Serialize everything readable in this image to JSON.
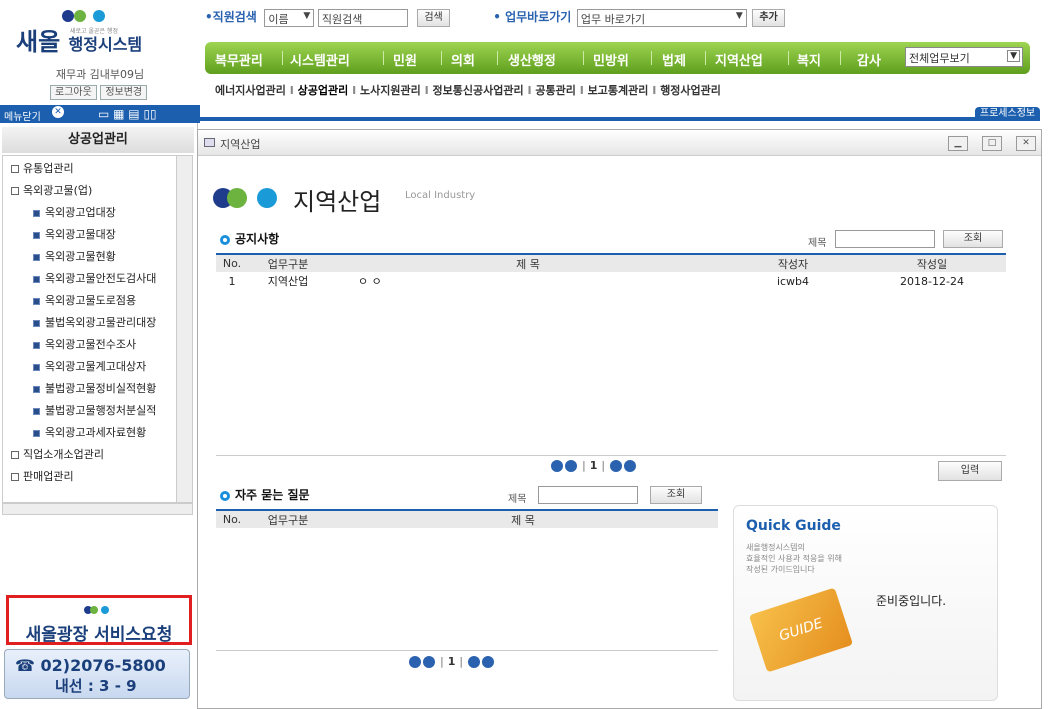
{
  "logo": {
    "title": "새올",
    "subtitle": "행정시스템",
    "tagline": "새로고 올곧은 행정",
    "user": "재무과 김내부09님",
    "logout": "로그아웃",
    "change_info": "정보변경"
  },
  "menu_bar": {
    "label": "메뉴닫기"
  },
  "search": {
    "label": "•직원검색",
    "select_value": "이름",
    "input_value": "직원검색",
    "button": "검색"
  },
  "quick": {
    "label": "• 업무바로가기",
    "select_value": "업무 바로가기",
    "add_button": "추가"
  },
  "nav": {
    "items": [
      "복무관리",
      "시스템관리",
      "민원",
      "의회",
      "생산행정",
      "민방위",
      "법제",
      "지역산업",
      "복지",
      "감사"
    ],
    "select_value": "전체업무보기"
  },
  "subnav": {
    "items": [
      "에너지사업관리",
      "상공업관리",
      "노사지원관리",
      "정보통신공사업관리",
      "공통관리",
      "보고통계관리",
      "행정사업관리"
    ]
  },
  "process_button": "프로세스정보",
  "sidebar": {
    "title": "상공업관리",
    "tree": [
      {
        "label": "유통업관리",
        "type": "folder"
      },
      {
        "label": "옥외광고물(업)",
        "type": "folder-open"
      },
      {
        "label": "옥외광고업대장",
        "type": "leaf"
      },
      {
        "label": "옥외광고물대장",
        "type": "leaf"
      },
      {
        "label": "옥외광고물현황",
        "type": "leaf"
      },
      {
        "label": "옥외광고물안전도검사대",
        "type": "leaf"
      },
      {
        "label": "옥외광고물도로점용",
        "type": "leaf"
      },
      {
        "label": "불법옥외광고물관리대장",
        "type": "leaf"
      },
      {
        "label": "옥외광고물전수조사",
        "type": "leaf"
      },
      {
        "label": "옥외광고물계고대상자",
        "type": "leaf"
      },
      {
        "label": "불법광고물정비실적현황",
        "type": "leaf"
      },
      {
        "label": "불법광고물행정처분실적",
        "type": "leaf"
      },
      {
        "label": "옥외광고과세자료현황",
        "type": "leaf"
      },
      {
        "label": "직업소개소업관리",
        "type": "folder"
      },
      {
        "label": "판매업관리",
        "type": "folder"
      }
    ],
    "service_request": "새올광장 서비스요청",
    "phone": "02)2076-5800",
    "extension": "내선 : 3 - 9"
  },
  "window": {
    "title": "지역산업",
    "page_title": "지역산업",
    "page_title_en": "Local Industry"
  },
  "notice": {
    "title": "공지사항",
    "search_label": "제목",
    "search_button": "조회",
    "columns": [
      "No.",
      "업무구분",
      "제 목",
      "작성자",
      "작성일"
    ],
    "rows": [
      {
        "no": "1",
        "category": "지역산업",
        "subject": "ㅇ ㅇ",
        "author": "icwb4",
        "date": "2018-12-24"
      }
    ],
    "page": "1",
    "input_button": "입력"
  },
  "faq": {
    "title": "자주 묻는 질문",
    "search_label": "제목",
    "search_button": "조회",
    "columns": [
      "No.",
      "업무구분",
      "제 목"
    ],
    "page": "1"
  },
  "guide": {
    "title": "Quick Guide",
    "desc_1": "새올행정시스템의",
    "desc_2": "효율적인 사용과 적응을 위해",
    "desc_3": "작성된 가이드입니다",
    "status": "준비중입니다.",
    "book_label": "GUIDE"
  },
  "colors": {
    "brand": "#1c5fae",
    "nav_green": "#6fb12a",
    "highlight": "#e02020"
  }
}
